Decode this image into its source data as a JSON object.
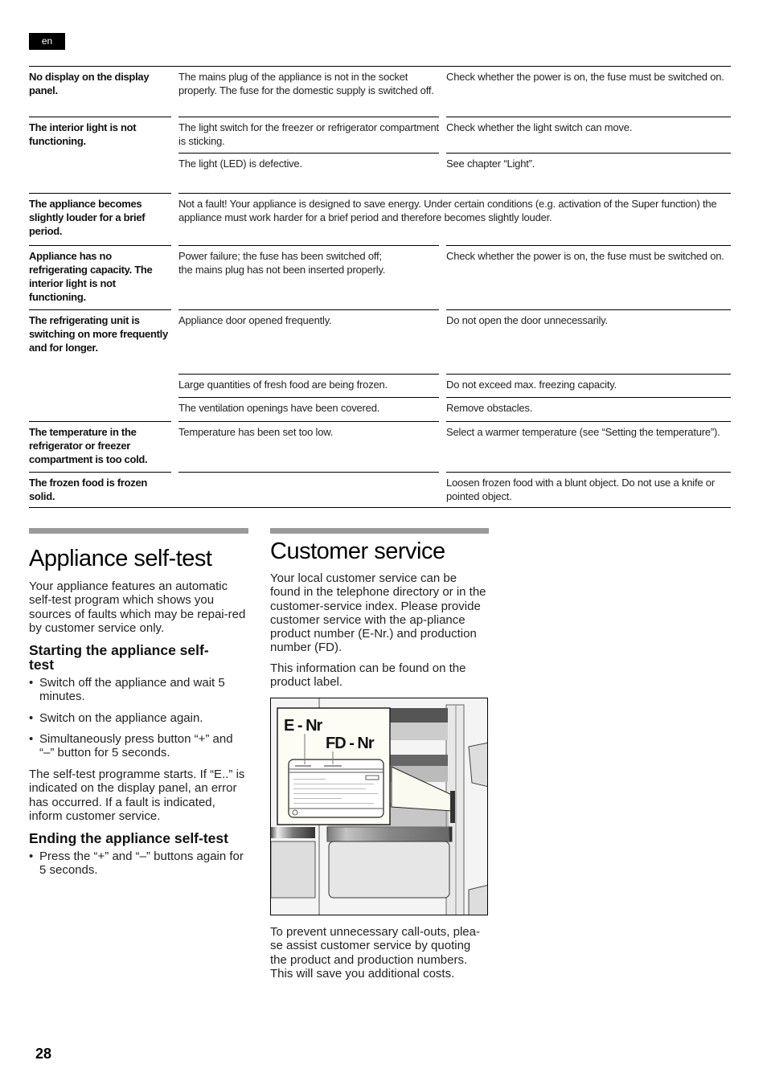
{
  "page": {
    "language_badge": "en",
    "page_number": "28"
  },
  "troubleshooting": {
    "rows": [
      {
        "fault": "No display on the display panel.",
        "entries": [
          {
            "cause": "The mains plug of the appliance is not in the socket properly. The fuse for the domestic supply is switched off.",
            "remedy": "Check whether the power is on, the fuse must be switched on."
          }
        ]
      },
      {
        "fault": "The interior light is not functioning.",
        "entries": [
          {
            "cause": "The light switch for the freezer or refrigerator compartment is sticking.",
            "remedy": "Check whether the light switch can move."
          },
          {
            "cause": "The light (LED) is defective.",
            "remedy": "See chapter “Light”."
          }
        ]
      },
      {
        "fault": "The appliance becomes slightly louder for a brief period.",
        "note": "Not a fault! Your appliance is designed to save energy. Under certain conditions (e.g. activation of the Super function) the appliance must work harder for a brief period and therefore becomes slightly louder."
      },
      {
        "fault": "Appliance has no refrigerating capacity. The interior light is not functioning.",
        "entries": [
          {
            "cause": "Power failure; the fuse has been switched off;\nthe mains plug has not been inserted properly.",
            "remedy": "Check whether the power is on, the fuse must be switched on."
          }
        ]
      },
      {
        "fault": "The refrigerating unit is switching on more frequently and for longer.",
        "entries": [
          {
            "cause": "Appliance door opened frequently.",
            "remedy": "Do not open the door unnecessarily."
          },
          {
            "cause": "Large quantities of fresh food are being frozen.",
            "remedy": "Do not exceed max. freezing capacity."
          },
          {
            "cause": "The ventilation openings have been covered.",
            "remedy": "Remove obstacles."
          }
        ]
      },
      {
        "fault": "The temperature in the refrigerator or freezer compartment is too cold.",
        "entries": [
          {
            "cause": "Temperature has been set too low.",
            "remedy": "Select a warmer temperature (see “Setting the temperature”)."
          }
        ]
      },
      {
        "fault": "The frozen food is frozen solid.",
        "entries": [
          {
            "cause": "",
            "remedy": "Loosen frozen food with a blunt object. Do not use a knife or pointed object."
          }
        ]
      }
    ]
  },
  "self_test": {
    "title": "Appliance self-test",
    "intro": "Your appliance features an automatic self-test program which shows you sources of faults which may be repai-red by customer service only.",
    "starting": {
      "heading": "Starting the appliance self-test",
      "steps": [
        "Switch off the appliance and wait 5 minutes.",
        "Switch on the appliance again.",
        "Simultaneously press button “+” and “–” button for 5 seconds."
      ],
      "result": "The self-test programme starts. If “E..” is indicated on the display panel, an error has occurred. If a fault is indicated, inform customer service."
    },
    "ending": {
      "heading": "Ending the appliance self-test",
      "steps": [
        "Press the “+” and “–” buttons again for 5 seconds."
      ]
    }
  },
  "customer_service": {
    "title": "Customer service",
    "intro": "Your local customer service can be found in the telephone directory or in the customer-service index. Please provide customer service with the ap-pliance product number (E-Nr.) and production number (FD).",
    "label_info": "This information can be found on the product label.",
    "figure": {
      "e_nr_label": "E - Nr",
      "fd_nr_label": "FD - Nr"
    },
    "closing": "To prevent unnecessary call-outs, plea-se assist customer service by quoting the product and production numbers. This will save you additional costs."
  }
}
